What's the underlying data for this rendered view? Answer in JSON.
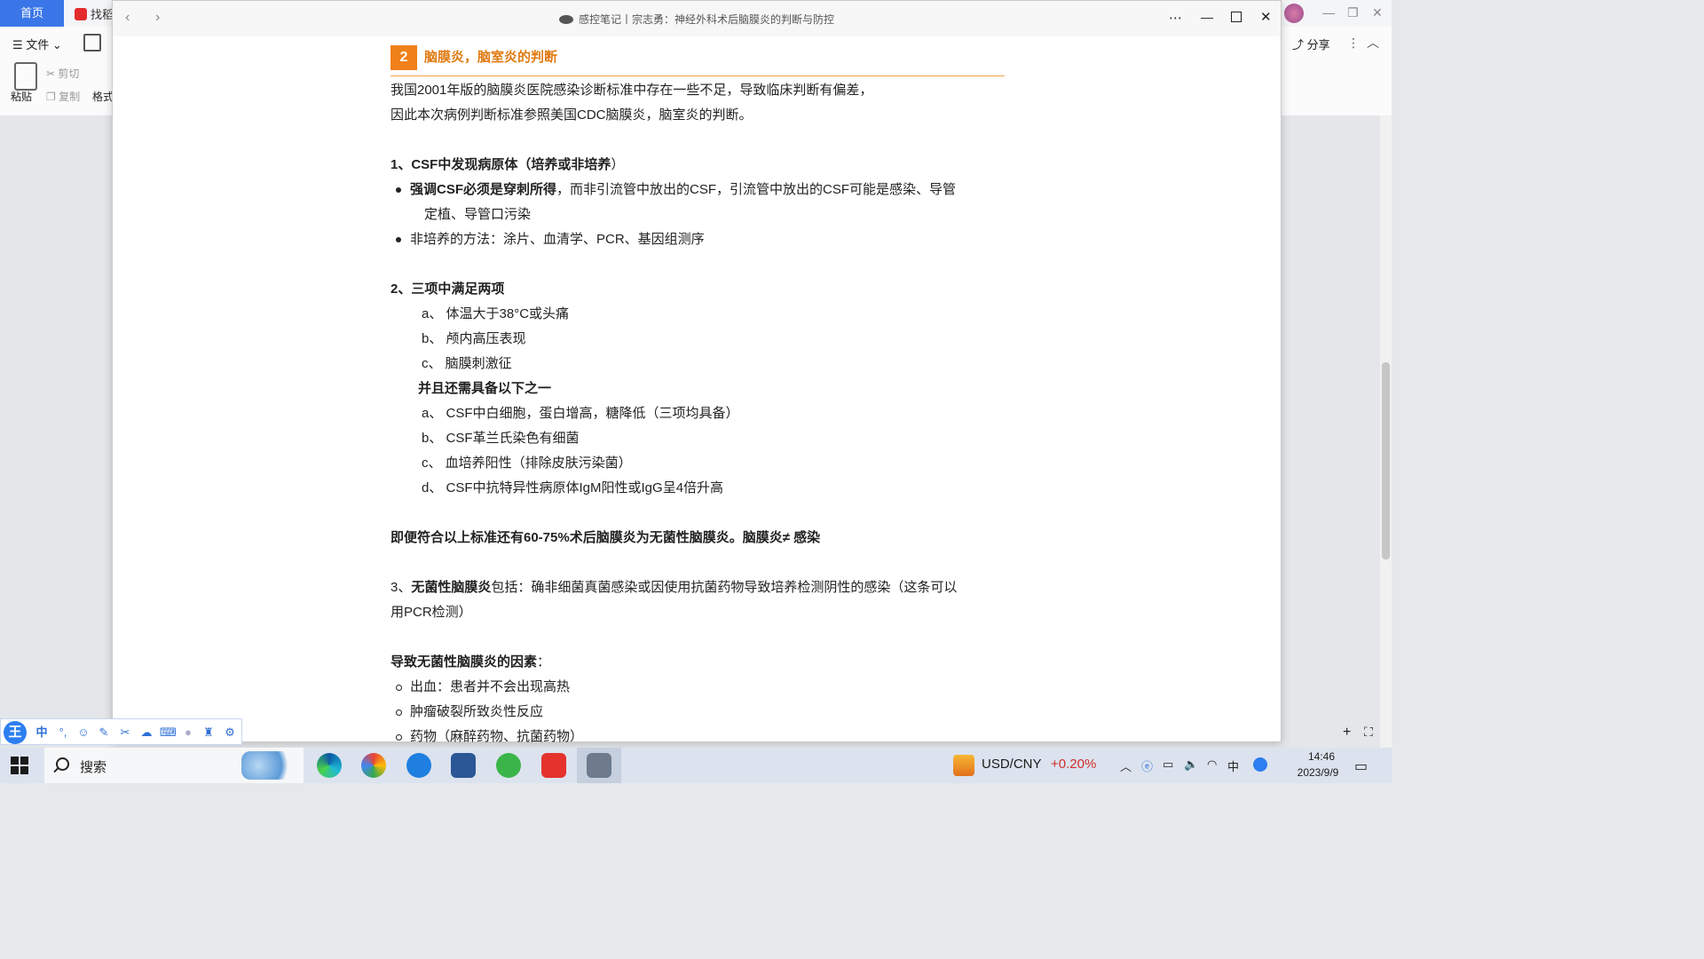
{
  "background_app": {
    "home_tab": "首页",
    "find_tab": "找稻",
    "file_menu": "文件",
    "paste": "粘贴",
    "cut": "剪切",
    "copy": "复制",
    "format": "格式",
    "share": "分享"
  },
  "window": {
    "title": "感控笔记丨宗志勇：神经外科术后脑膜炎的判断与防控"
  },
  "article": {
    "section_number": "2",
    "section_title": "脑膜炎，脑室炎的判断",
    "intro_1": "我国2001年版的脑膜炎医院感染诊断标准中存在一些不足，导致临床判断有偏差，",
    "intro_2": "因此本次病例判断标准参照美国CDC脑膜炎，脑室炎的判断。",
    "c1_title": "1、CSF中发现病原体（培养或非培养",
    "c1_title_end": "）",
    "c1_b1_bold": "强调CSF必须是穿刺所得",
    "c1_b1_rest": "，而非引流管中放出的CSF，引流管中放出的CSF可能是感染、导管",
    "c1_b1_cont": "定植、导管口污染",
    "c1_b2": "非培养的方法：涂片、血清学、PCR、基因组测序",
    "c2_title": "2、三项中满足两项",
    "c2_items": [
      "a、  体温大于38°C或头痛",
      "b、  颅内高压表现",
      "c、  脑膜刺激征"
    ],
    "c2_also": "并且还需具备以下之一",
    "c2_items2": [
      "a、  CSF中白细胞，蛋白增高，糖降低（三项均具备）",
      "b、  CSF革兰氏染色有细菌",
      "c、  血培养阳性（排除皮肤污染菌）",
      "d、  CSF中抗特异性病原体IgM阳性或IgG呈4倍升高"
    ],
    "note": "即便符合以上标准还有60-75%术后脑膜炎为无菌性脑膜炎。脑膜炎≠ 感染",
    "c3_prefix": "3、",
    "c3_bold": "无菌性脑膜炎",
    "c3_rest": "包括：确非细菌真菌感染或因使用抗菌药物导致培养检测阴性的感染（这条可以",
    "c3_cont": "用PCR检测）",
    "factors_title": "导致无菌性脑膜炎的因素",
    "factors_colon": "：",
    "factors": [
      "出血：患者并不会出现高热",
      "肿瘤破裂所致炎性反应",
      "药物（麻醉药物、抗菌药物）"
    ]
  },
  "ime": {
    "logo": "王",
    "mode": "中"
  },
  "taskbar": {
    "search_label": "搜索",
    "currency_pair": "USD/CNY",
    "currency_change": "+0.20%",
    "ime_indicator": "中",
    "time": "14:46",
    "date": "2023/9/9"
  }
}
